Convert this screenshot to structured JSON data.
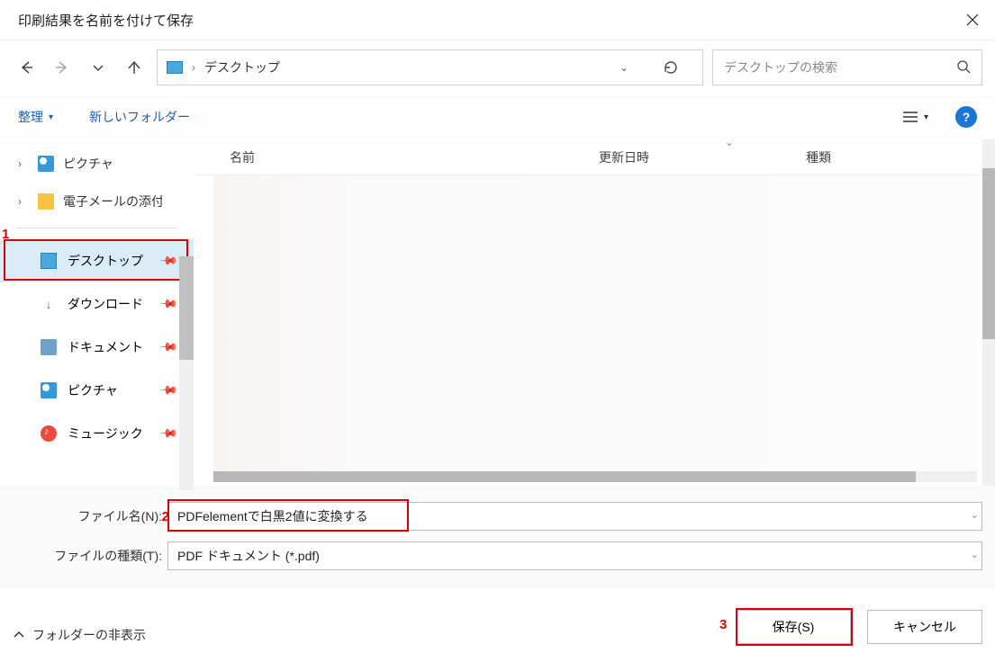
{
  "title": "印刷結果を名前を付けて保存",
  "addressbar": {
    "location": "デスクトップ"
  },
  "search": {
    "placeholder": "デスクトップの検索"
  },
  "toolbar": {
    "organize": "整理",
    "newfolder": "新しいフォルダー"
  },
  "tree": {
    "upper": [
      {
        "label": "ピクチャ"
      },
      {
        "label": "電子メールの添付"
      }
    ],
    "quick": [
      {
        "label": "デスクトップ",
        "selected": true
      },
      {
        "label": "ダウンロード"
      },
      {
        "label": "ドキュメント"
      },
      {
        "label": "ピクチャ"
      },
      {
        "label": "ミュージック"
      }
    ]
  },
  "columns": {
    "name": "名前",
    "date": "更新日時",
    "type": "種類"
  },
  "form": {
    "filename_label": "ファイル名(N):",
    "filename_value": "PDFelementで白黒2値に変換する",
    "filetype_label": "ファイルの種類(T):",
    "filetype_value": "PDF ドキュメント (*.pdf)"
  },
  "footer": {
    "hidefolders": "フォルダーの非表示",
    "save": "保存(S)",
    "cancel": "キャンセル"
  },
  "annotations": {
    "a1": "1",
    "a2": "2",
    "a3": "3"
  }
}
